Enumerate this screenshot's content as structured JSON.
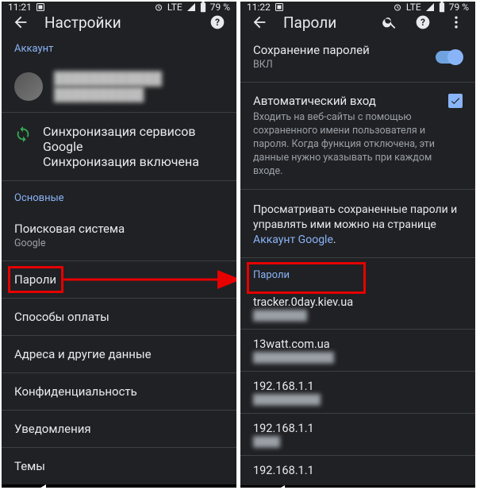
{
  "left": {
    "status": {
      "time": "11:21",
      "net": "LTE",
      "battery": "79 %"
    },
    "appbar": {
      "title": "Настройки"
    },
    "section_account": "Аккаунт",
    "account": {
      "line1": "████████████",
      "line2": "██████████"
    },
    "sync": {
      "title": "Синхронизация сервисов Google",
      "sub": "Синхронизация включена"
    },
    "section_main": "Основные",
    "search_engine": {
      "title": "Поисковая система",
      "sub": "Google"
    },
    "passwords": {
      "title": "Пароли"
    },
    "payment": {
      "title": "Способы оплаты"
    },
    "addresses": {
      "title": "Адреса и другие данные"
    },
    "privacy": {
      "title": "Конфиденциальность"
    },
    "notifications": {
      "title": "Уведомления"
    },
    "themes": {
      "title": "Темы"
    }
  },
  "right": {
    "status": {
      "time": "11:22",
      "net": "LTE",
      "battery": "79 %"
    },
    "appbar": {
      "title": "Пароли"
    },
    "save": {
      "title": "Сохранение паролей",
      "sub": "ВКЛ"
    },
    "autologin": {
      "title": "Автоматический вход",
      "desc": "Входить на веб-сайты с помощью сохраненного имени пользователя и пароля. Когда функция отключена, эти данные нужно указывать при каждом входе."
    },
    "info": {
      "text": "Просматривать сохраненные пароли и управлять ими можно на странице ",
      "link": "Аккаунт Google"
    },
    "section_passwords": "Пароли",
    "items": [
      {
        "site": "tracker.0day.kiev.ua",
        "user": "████████"
      },
      {
        "site": "13watt.com.ua",
        "user": "████████████"
      },
      {
        "site": "192.168.1.1",
        "user": "██████████"
      },
      {
        "site": "192.168.1.1",
        "user": "████"
      },
      {
        "site": "192.168.1.1",
        "user": ""
      }
    ]
  }
}
